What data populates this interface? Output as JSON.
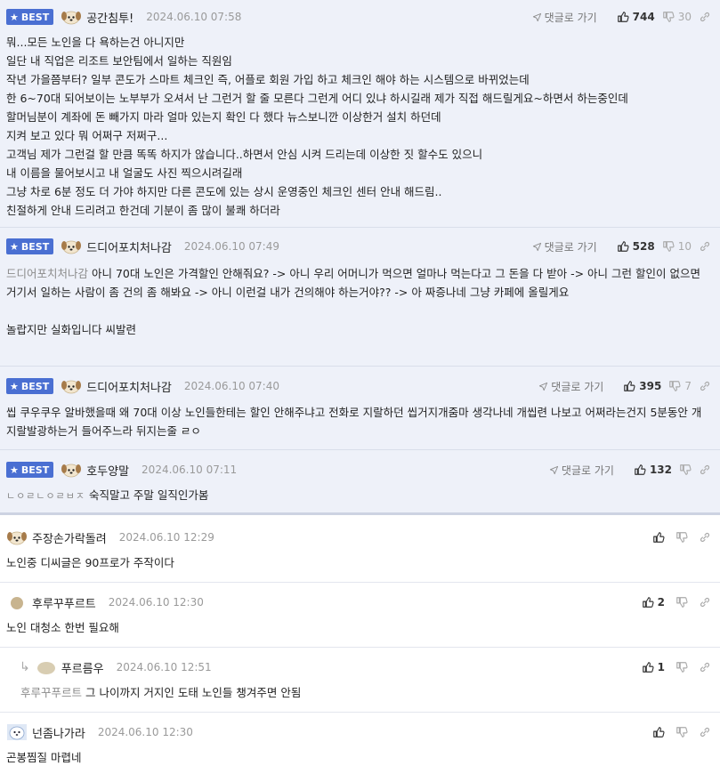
{
  "best_label": "BEST",
  "reply_label": "댓글로 가기",
  "comments": [
    {
      "nick": "공간침투!",
      "time": "2024.06.10 07:58",
      "up": "744",
      "down": "30",
      "lines": [
        "뭐...모든 노인을 다 욕하는건 아니지만",
        "일단 내 직업은 리조트 보안팀에서 일하는 직원임",
        "작년 가을쯤부터? 일부 콘도가 스마트 체크인 즉, 어플로 회원 가입 하고 체크인 해야 하는 시스템으로 바뀌었는데",
        "한 6~70대 되어보이는 노부부가 오셔서 난 그런거 할 줄 모른다 그런게 어디 있냐 하시길래 제가 직접 해드릴게요~하면서 하는중인데",
        "할머님분이 계좌에 돈 빼가지 마라 얼마 있는지 확인 다 했다 뉴스보니깐 이상한거 설치 하던데",
        "지켜 보고 있다 뭐 어쩌구 저쩌구...",
        "고객님 제가 그런걸 할 만큼 똑똑 하지가 않습니다..하면서 안심 시켜 드리는데 이상한 짓 할수도 있으니",
        "내 이름을 물어보시고 내 얼굴도 사진 찍으시려길래",
        "그냥 차로 6분 정도 더 가야 하지만 다른 콘도에 있는 상시 운영중인 체크인 센터 안내 해드림..",
        "친절하게 안내 드리려고 한건데 기분이 좀 많이 불쾌 하더라"
      ]
    },
    {
      "nick": "드디어포치처나감",
      "time": "2024.06.10 07:49",
      "up": "528",
      "down": "10",
      "mention": "드디어포치처나감",
      "text": " 아니 70대 노인은 가격할인 안해줘요? -> 아니 우리 어머니가 먹으면 얼마나 먹는다고 그 돈을 다 받아 -> 아니 그런 할인이 없으면 거기서 일하는 사람이 좀 건의 좀 해봐요 -> 아니 이런걸 내가 건의해야 하는거야?? -> 아 짜증나네 그냥 카페에 올릴게요",
      "extra": "놀랍지만 실화입니다 씨발련"
    },
    {
      "nick": "드디어포치처나감",
      "time": "2024.06.10 07:40",
      "up": "395",
      "down": "7",
      "text": "씹 쿠우쿠우 알바했을때 왜 70대 이상 노인들한테는 할인 안해주냐고 전화로 지랄하던 씹거지개줌마 생각나네 개씹련 나보고 어쩌라는건지 5분동안 개지랄발광하는거 들어주느라 뒤지는줄 ㄹㅇ"
    },
    {
      "nick": "호두양말",
      "time": "2024.06.10 07:11",
      "up": "132",
      "down": "",
      "consonants": "ㄴㅇㄹㄴㅇㄹㅂㅈ",
      "text": " 숙직말고 주말 일직인가봄"
    },
    {
      "nick": "주장손가락돌려",
      "time": "2024.06.10 12:29",
      "up": "",
      "text": "노인중 디씨글은 90프로가 주작이다"
    },
    {
      "nick": "후루꾸푸르트",
      "time": "2024.06.10 12:30",
      "up": "2",
      "text": "노인 대청소 한번 필요해"
    },
    {
      "nick": "푸르름우",
      "time": "2024.06.10 12:51",
      "up": "1",
      "mention": "후루꾸푸르트",
      "text": " 그 나이까지 거지인 도태 노인들 챙겨주면 안됨"
    },
    {
      "nick": "넌좀나가라",
      "time": "2024.06.10 12:30",
      "up": "",
      "text": "곤봉찜질 마렵네"
    }
  ]
}
